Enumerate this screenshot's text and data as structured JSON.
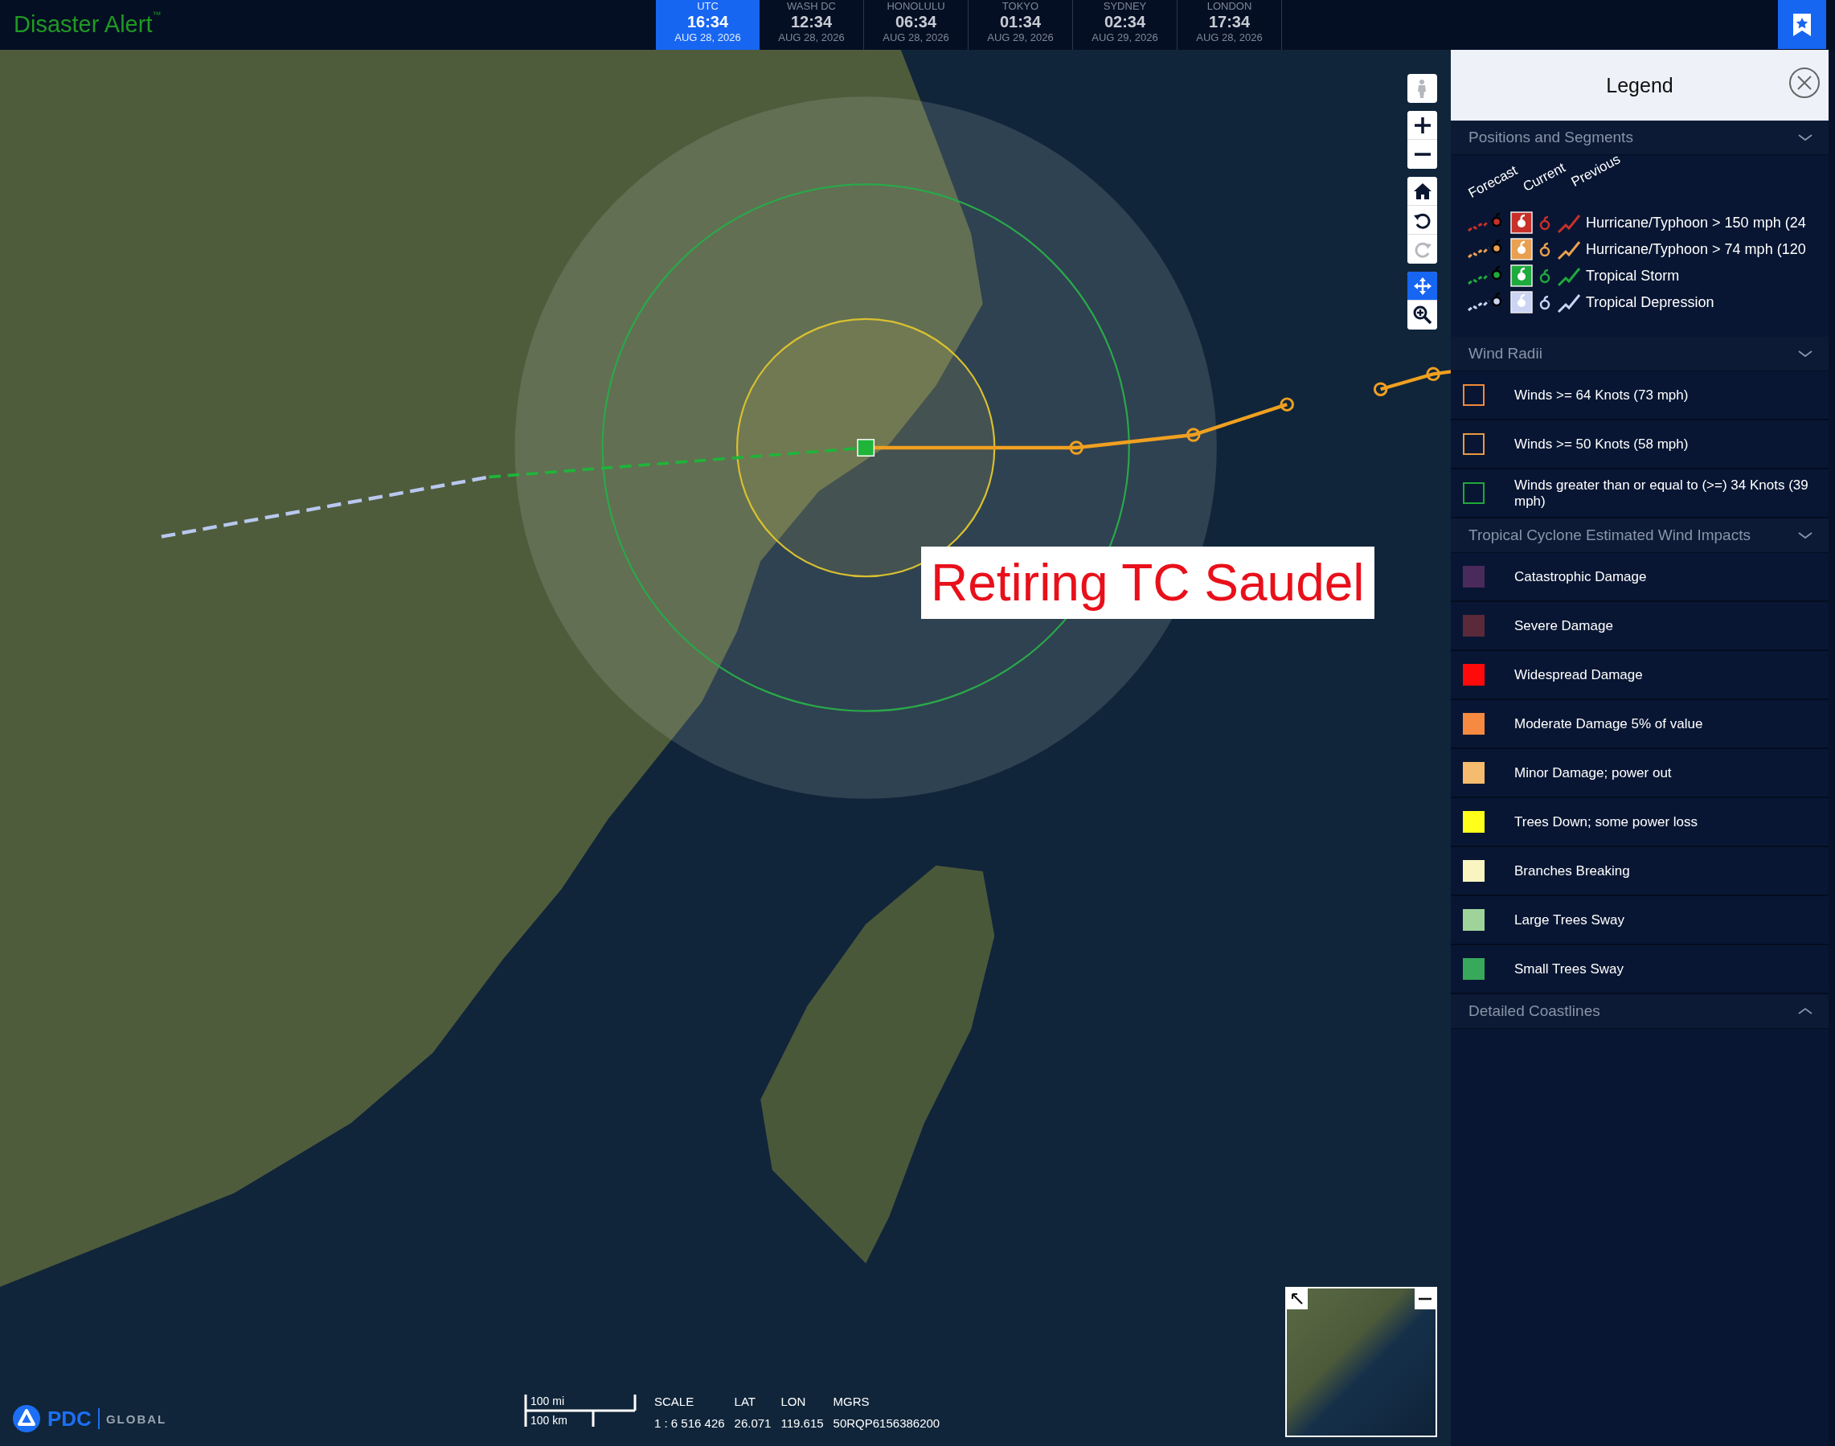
{
  "app": {
    "title": "Disaster Alert",
    "trademark": "™"
  },
  "clocks": [
    {
      "city": "UTC",
      "time": "16:34",
      "date": "AUG 28, 2026",
      "selected": true
    },
    {
      "city": "WASH DC",
      "time": "12:34",
      "date": "AUG 28, 2026",
      "selected": false
    },
    {
      "city": "HONOLULU",
      "time": "06:34",
      "date": "AUG 28, 2026",
      "selected": false
    },
    {
      "city": "TOKYO",
      "time": "01:34",
      "date": "AUG 29, 2026",
      "selected": false
    },
    {
      "city": "SYDNEY",
      "time": "02:34",
      "date": "AUG 29, 2026",
      "selected": false
    },
    {
      "city": "LONDON",
      "time": "17:34",
      "date": "AUG 28, 2026",
      "selected": false
    }
  ],
  "map": {
    "annotation": "Retiring TC Saudel",
    "tool_groups": [
      {
        "tools": [
          {
            "kind": "person",
            "disabled": true,
            "selected": false
          }
        ]
      },
      {
        "tools": [
          {
            "kind": "zoom-in",
            "disabled": false,
            "selected": false
          },
          {
            "kind": "zoom-out",
            "disabled": false,
            "selected": false
          }
        ]
      },
      {
        "tools": [
          {
            "kind": "home",
            "disabled": false,
            "selected": false
          },
          {
            "kind": "rotate-left",
            "disabled": false,
            "selected": false
          },
          {
            "kind": "rotate-right",
            "disabled": true,
            "selected": false
          }
        ]
      },
      {
        "tools": [
          {
            "kind": "pan",
            "disabled": false,
            "selected": true
          },
          {
            "kind": "zoom-box",
            "disabled": false,
            "selected": false
          }
        ]
      }
    ],
    "scale_bar": {
      "miles": "100 mi",
      "km": "100 km"
    },
    "readouts": [
      {
        "label": "SCALE",
        "value": "1 : 6 516 426"
      },
      {
        "label": "LAT",
        "value": "26.071"
      },
      {
        "label": "LON",
        "value": "119.615"
      },
      {
        "label": "MGRS",
        "value": "50RQP6156386200"
      }
    ],
    "logo": {
      "brand": "PDC",
      "tagline": "GLOBAL"
    }
  },
  "legend": {
    "title": "Legend",
    "sections": [
      {
        "title": "Positions and Segments",
        "kind": "positions",
        "expanded": true,
        "column_headers": [
          "Forecast",
          "Current",
          "Previous"
        ],
        "items": [
          {
            "label": "Hurricane/Typhoon > 150 mph (24",
            "color": "#c8302a"
          },
          {
            "label": "Hurricane/Typhoon > 74 mph (120",
            "color": "#eaa050"
          },
          {
            "label": "Tropical Storm",
            "color": "#1eaa3c"
          },
          {
            "label": "Tropical Depression",
            "color": "#ccd4f4"
          }
        ]
      },
      {
        "title": "Wind Radii",
        "kind": "outline",
        "expanded": true,
        "items": [
          {
            "label": "Winds >= 64 Knots (73 mph)",
            "color": "#f08a3a"
          },
          {
            "label": "Winds >= 50 Knots (58 mph)",
            "color": "#e89a40"
          },
          {
            "label": "Winds greater than or equal to (>=) 34 Knots (39 mph)",
            "color": "#1fa83a"
          }
        ]
      },
      {
        "title": "Tropical Cyclone Estimated Wind Impacts",
        "kind": "fill",
        "expanded": true,
        "items": [
          {
            "label": "Catastrophic Damage",
            "color": "#4a2a5a"
          },
          {
            "label": "Severe Damage",
            "color": "#5a2a3a"
          },
          {
            "label": "Widespread Damage",
            "color": "#ff0a0a"
          },
          {
            "label": "Moderate Damage 5% of value",
            "color": "#f58a40"
          },
          {
            "label": "Minor Damage; power out",
            "color": "#f5bb6e"
          },
          {
            "label": "Trees Down; some power loss",
            "color": "#ffff1a"
          },
          {
            "label": "Branches Breaking",
            "color": "#f8f5c0"
          },
          {
            "label": "Large Trees Sway",
            "color": "#9ed49a"
          },
          {
            "label": "Small Trees Sway",
            "color": "#38a85a"
          }
        ]
      },
      {
        "title": "Detailed Coastlines",
        "expanded": false
      }
    ]
  }
}
